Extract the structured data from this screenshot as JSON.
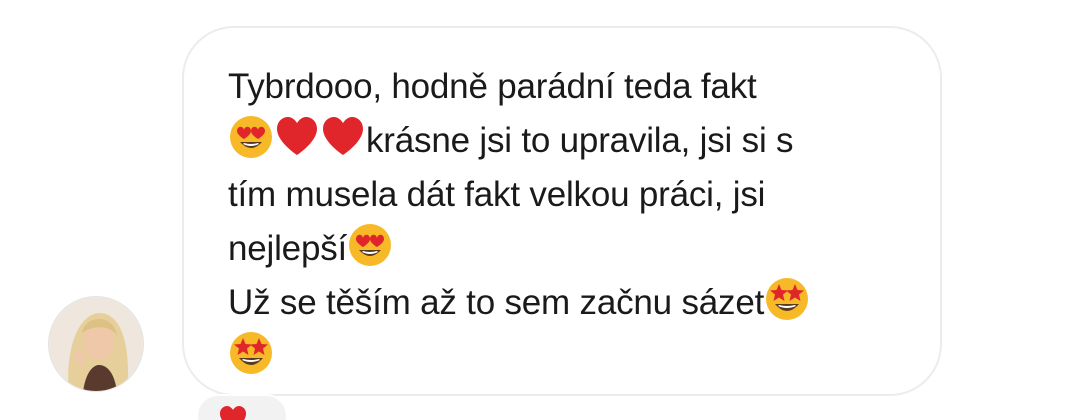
{
  "message": {
    "lines": [
      "Tybrdooo, hodně parádní teda fakt",
      "krásne jsi to upravila, jsi si s",
      "tím musela dát fakt velkou práci, jsi",
      "nejlepší",
      "Už se těším až to sem začnu sázet"
    ],
    "emojis": [
      "smiling-face-with-heart-eyes",
      "red-heart",
      "red-heart",
      "smiling-face-with-heart-eyes",
      "star-struck",
      "star-struck"
    ]
  },
  "reaction": {
    "icon": "red-heart"
  },
  "colors": {
    "bubble_border": "#ececec",
    "text": "#1a1a1a",
    "heart": "#e0252b",
    "emoji_face": "#f7b928"
  }
}
